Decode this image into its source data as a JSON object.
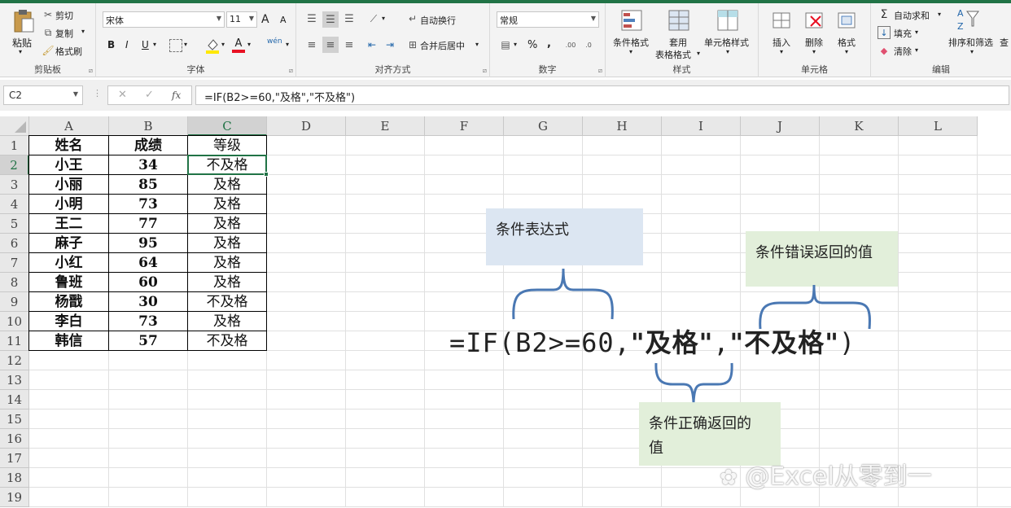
{
  "ribbon": {
    "clipboard": {
      "label": "剪贴板",
      "paste": "粘贴",
      "cut": "剪切",
      "copy": "复制",
      "format_painter": "格式刷"
    },
    "font": {
      "label": "字体",
      "font_name": "宋体",
      "font_size": "11",
      "bold": "B",
      "italic": "I",
      "underline": "U",
      "grow": "A",
      "shrink": "A",
      "color_letter": "A",
      "wen": "wén"
    },
    "alignment": {
      "label": "对齐方式",
      "wrap": "自动换行",
      "merge": "合并后居中"
    },
    "number": {
      "label": "数字",
      "format": "常规",
      "percent": "%",
      "comma": ","
    },
    "styles": {
      "label": "样式",
      "conditional": "条件格式",
      "table_format_1": "套用",
      "table_format_2": "表格格式",
      "cell_style": "单元格样式"
    },
    "cells": {
      "label": "单元格",
      "insert": "插入",
      "delete": "删除",
      "format": "格式"
    },
    "editing": {
      "label": "编辑",
      "autosum": "自动求和",
      "fill": "填充",
      "clear": "清除",
      "sort": "排序和筛选",
      "find": "查"
    }
  },
  "formula_bar": {
    "name_box": "C2",
    "cancel": "✕",
    "enter": "✓",
    "fx": "fx",
    "formula": "=IF(B2>=60,\"及格\",\"不及格\")"
  },
  "columns": [
    "A",
    "B",
    "C",
    "D",
    "E",
    "F",
    "G",
    "H",
    "I",
    "J",
    "K",
    "L"
  ],
  "rows": [
    "1",
    "2",
    "3",
    "4",
    "5",
    "6",
    "7",
    "8",
    "9",
    "10",
    "11",
    "12",
    "13",
    "14",
    "15",
    "16",
    "17",
    "18",
    "19"
  ],
  "table": {
    "headers": [
      "姓名",
      "成绩",
      "等级"
    ],
    "rows": [
      [
        "小王",
        "34",
        "不及格"
      ],
      [
        "小丽",
        "85",
        "及格"
      ],
      [
        "小明",
        "73",
        "及格"
      ],
      [
        "王二",
        "77",
        "及格"
      ],
      [
        "麻子",
        "95",
        "及格"
      ],
      [
        "小红",
        "64",
        "及格"
      ],
      [
        "鲁班",
        "60",
        "及格"
      ],
      [
        "杨戬",
        "30",
        "不及格"
      ],
      [
        "李白",
        "73",
        "及格"
      ],
      [
        "韩信",
        "57",
        "不及格"
      ]
    ]
  },
  "annotations": {
    "condition": "条件表达式",
    "false_value": "条件错误返回的值",
    "true_value_1": "条件正确返回的",
    "true_value_2": "值",
    "formula_prefix": "=IF(B2>=60,",
    "formula_true": "\"及格\"",
    "formula_comma": ",",
    "formula_false": "\"不及格\"",
    "formula_end": ")"
  },
  "watermark": "@Excel从零到一",
  "colors": {
    "excel_green": "#217346",
    "blue_box": "#dce6f2",
    "green_box": "#e2efda",
    "brace": "#4a78b3"
  }
}
